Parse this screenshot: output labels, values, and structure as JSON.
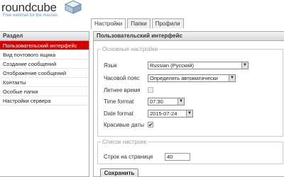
{
  "logo": {
    "name": "roundcube",
    "tagline": "Free webmail for the masses"
  },
  "tabs": [
    {
      "label": "Настройки",
      "active": true
    },
    {
      "label": "Папки",
      "active": false
    },
    {
      "label": "Профили",
      "active": false
    }
  ],
  "sidebar": {
    "header": "Раздел",
    "items": [
      {
        "label": "Пользовательский интерфейс",
        "selected": true
      },
      {
        "label": "Вид почтового ящика",
        "selected": false
      },
      {
        "label": "Создание сообщений",
        "selected": false
      },
      {
        "label": "Отображение сообщений",
        "selected": false
      },
      {
        "label": "Контакты",
        "selected": false
      },
      {
        "label": "Особые папки",
        "selected": false
      },
      {
        "label": "Настройки сервера",
        "selected": false
      }
    ]
  },
  "main": {
    "header": "Пользовательский интерфейс",
    "main_group": {
      "legend": "Основные настройки",
      "language_label": "Язык",
      "language_value": "Russian (Русский)",
      "timezone_label": "Часовой пояс",
      "timezone_value": "Определять автоматически",
      "dst_label": "Летнее время",
      "dst_checked": false,
      "time_format_label": "Time format",
      "time_format_value": "07:30",
      "date_format_label": "Date format",
      "date_format_value": "2015-07-24",
      "pretty_dates_label": "Красивые даты",
      "pretty_dates_checked": true
    },
    "list_group": {
      "legend": "Список настроек",
      "rows_per_page_label": "Строк на странице",
      "rows_per_page_value": "40"
    }
  },
  "save_button": "Сохранить",
  "colors": {
    "selected_bg": "#d00000",
    "selected_text": "#ffffff",
    "accent": "#6b8fae"
  }
}
